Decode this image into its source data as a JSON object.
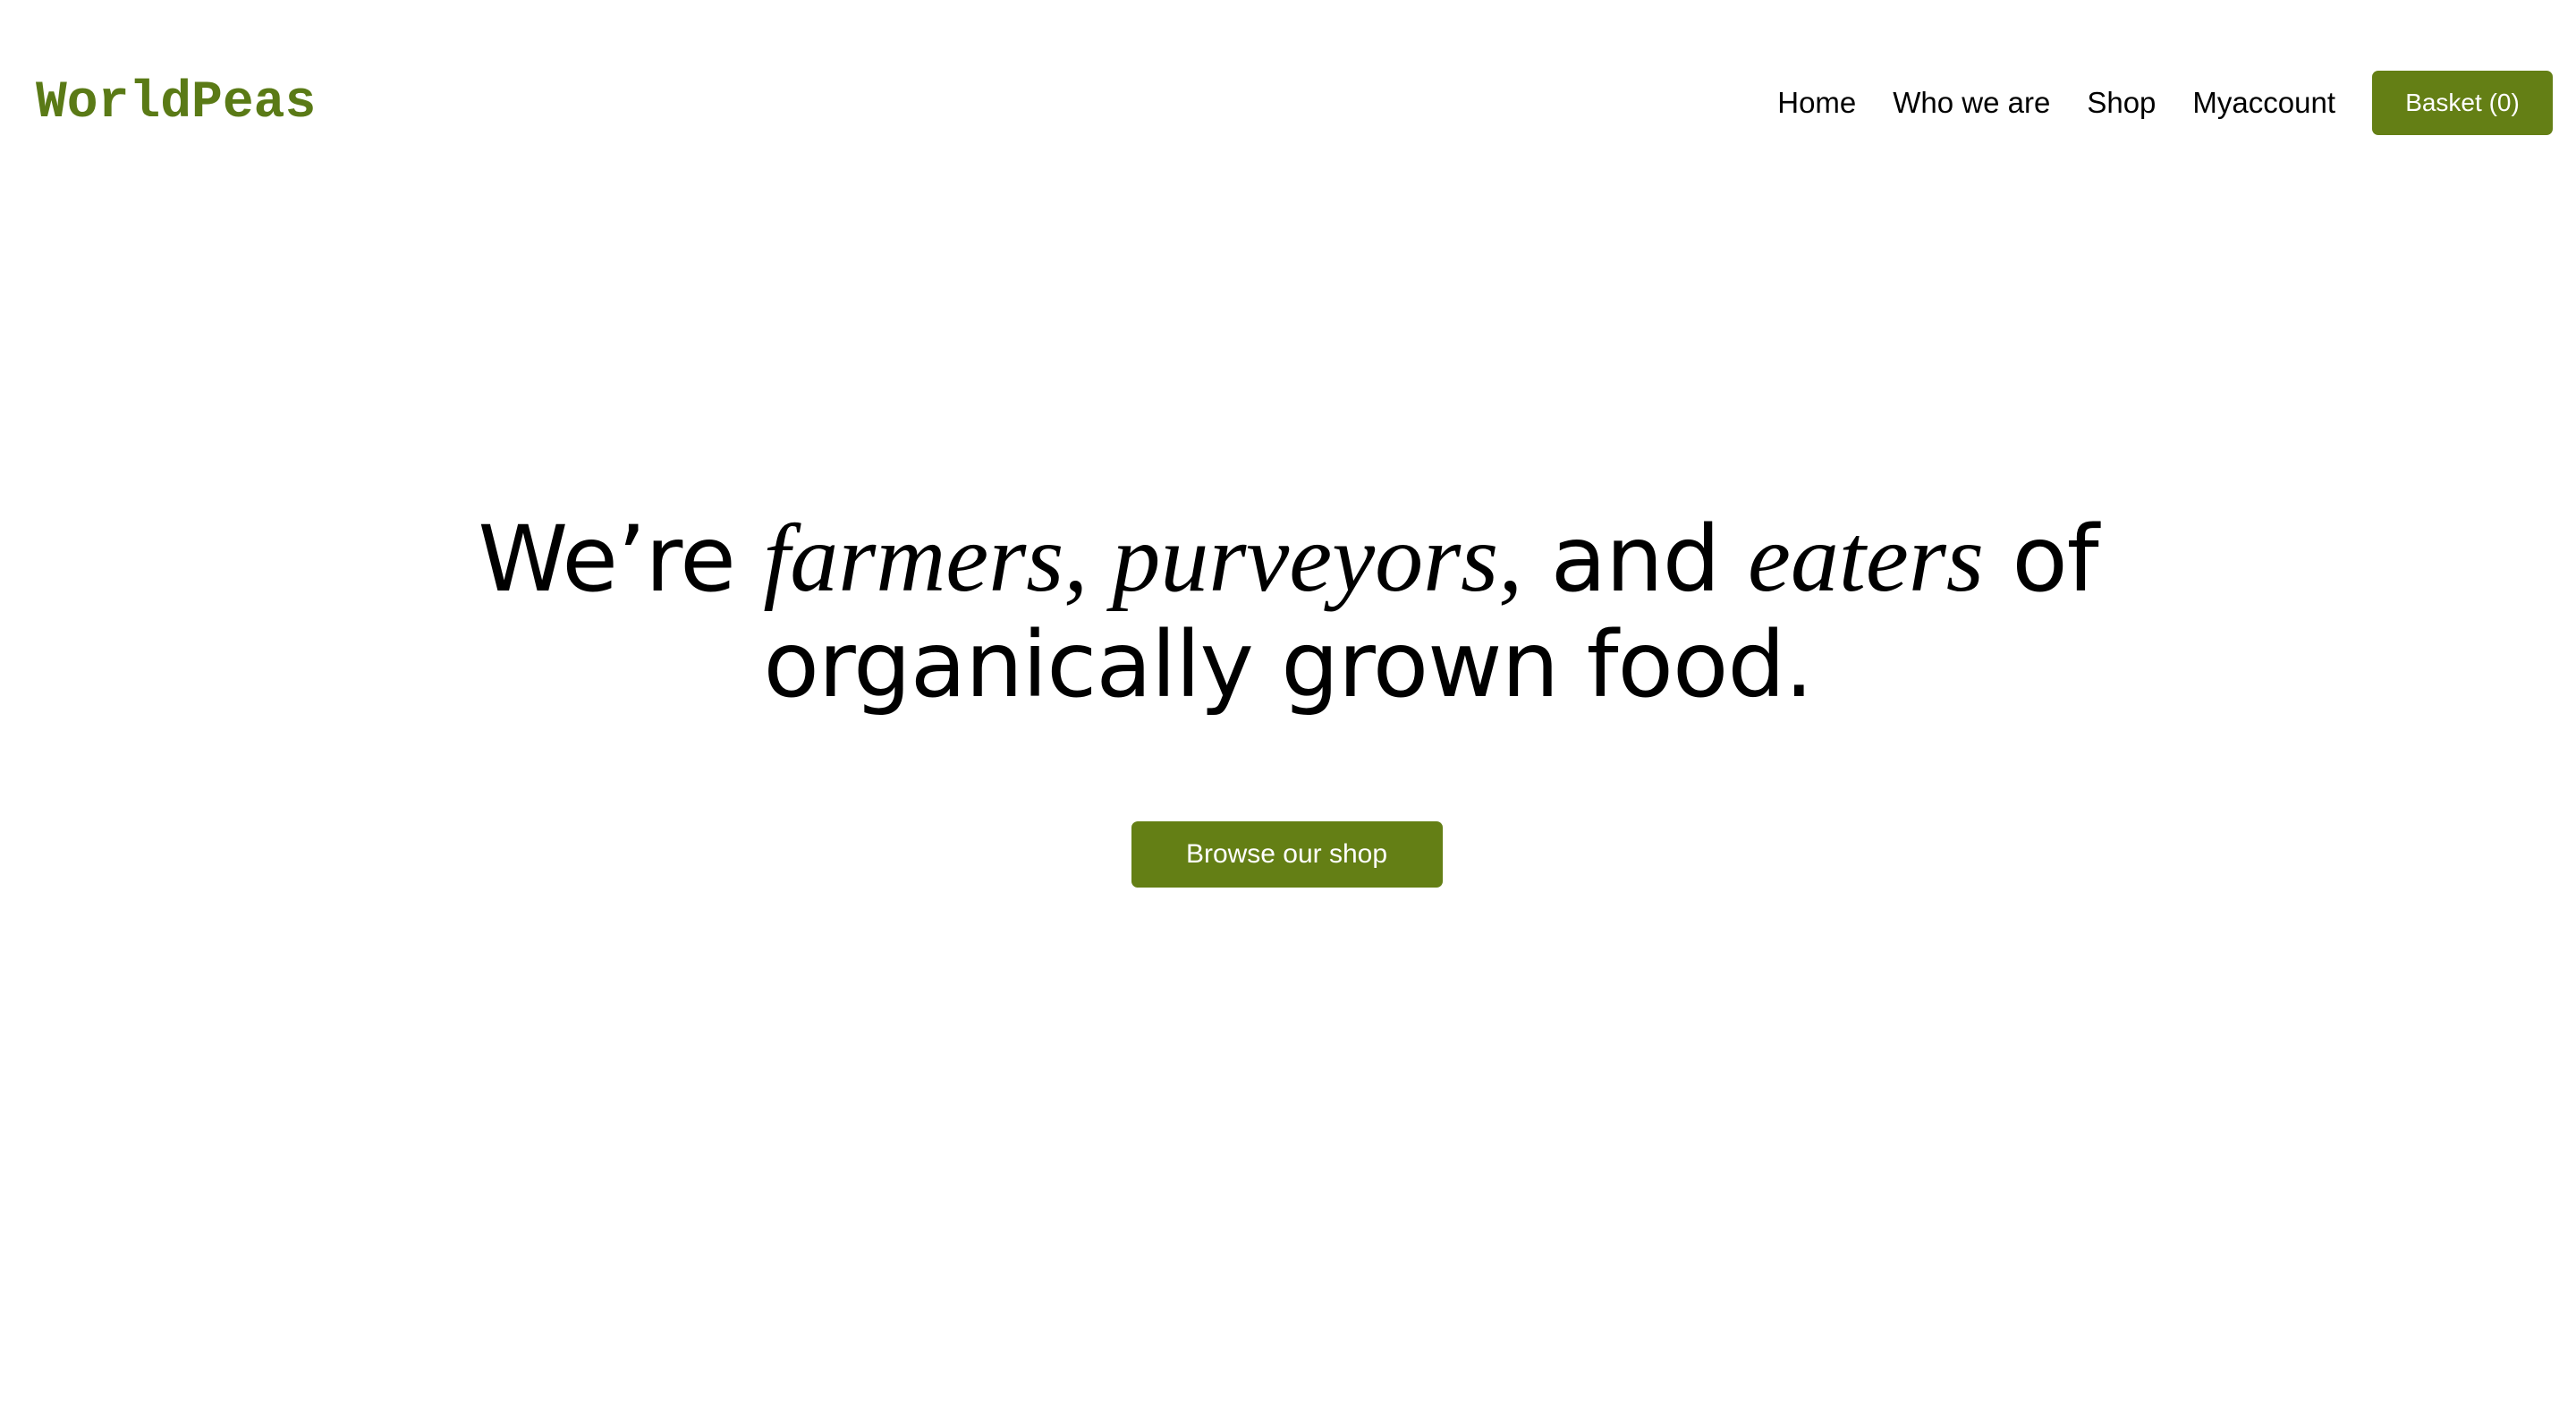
{
  "header": {
    "logo": "WorldPeas",
    "nav": [
      {
        "label": "Home"
      },
      {
        "label": "Who we are"
      },
      {
        "label": "Shop"
      },
      {
        "label": "Myaccount"
      }
    ],
    "basket_label": "Basket (0)"
  },
  "hero": {
    "headline": {
      "part1": "We’re ",
      "farmers": "farmers,",
      "space1": " ",
      "purveyors": "purveyors,",
      "part2": " and ",
      "eaters": "eaters",
      "part3": " of",
      "line2": "organically grown food."
    },
    "cta_label": "Browse our shop"
  },
  "colors": {
    "brand_green": "#647f15",
    "logo_green": "#5a7a16",
    "text": "#000000",
    "background": "#ffffff"
  }
}
